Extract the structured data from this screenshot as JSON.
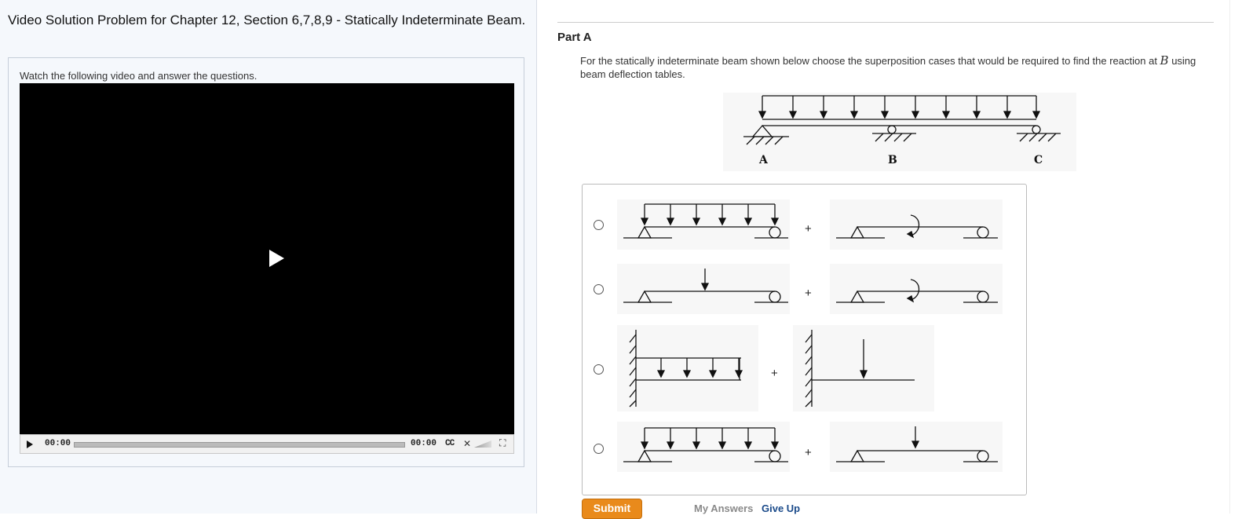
{
  "left": {
    "title": "Video Solution Problem for Chapter 12, Section 6,7,8,9 - Statically Indeterminate Beam.",
    "intro": "Watch the following video and answer the questions.",
    "player": {
      "current_time": "00:00",
      "duration": "00:00",
      "cc_label": "CC",
      "progress": 0
    }
  },
  "part": {
    "title": "Part A",
    "question_prefix": "For the statically indeterminate beam shown below choose the superposition cases that would be required to find the reaction at ",
    "question_var": "B",
    "question_suffix": " using beam deflection tables."
  },
  "main_figure": {
    "labels": [
      "A",
      "B",
      "C"
    ]
  },
  "options": [
    {
      "plus": "+"
    },
    {
      "plus": "+"
    },
    {
      "plus": "+"
    },
    {
      "plus": "+"
    }
  ],
  "buttons": {
    "submit": "Submit",
    "my_answers": "My Answers",
    "give_up": "Give Up"
  },
  "colors": {
    "submit_bg": "#e98a1b",
    "link": "#1a4a8a",
    "left_bg": "#f5f8fc"
  }
}
